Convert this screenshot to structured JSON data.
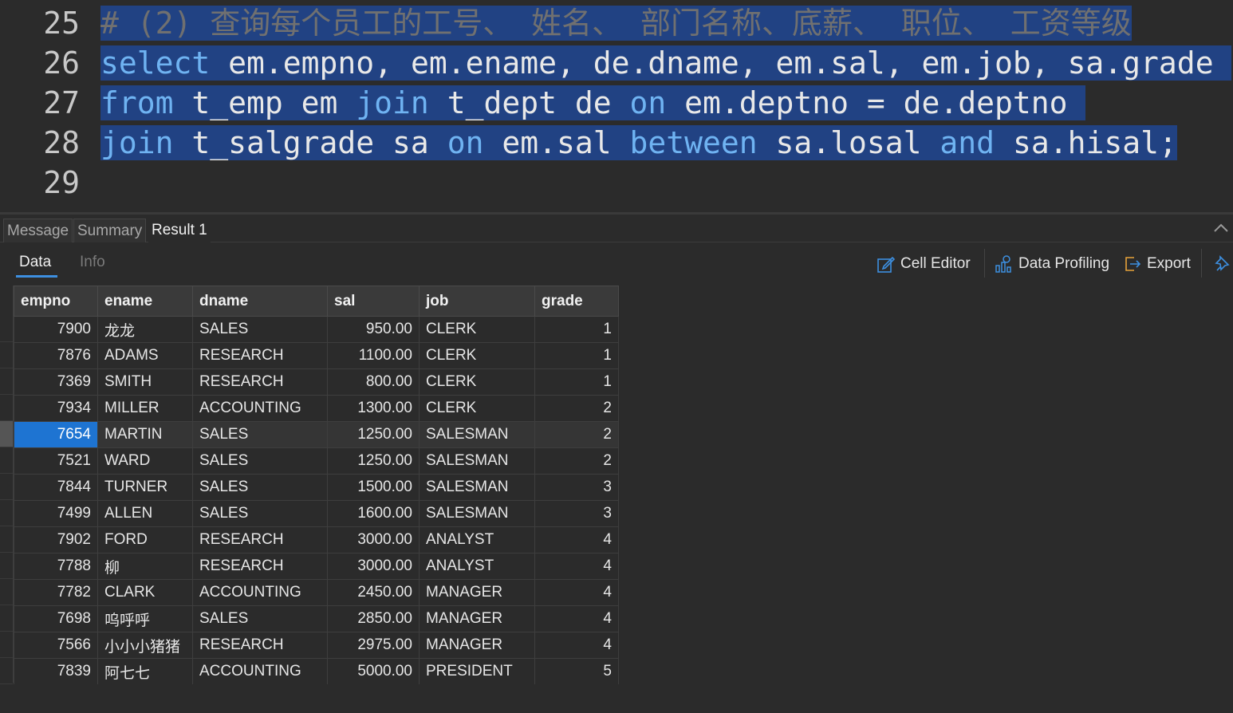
{
  "editor": {
    "lines": [
      {
        "num": "25",
        "tokens": [
          {
            "t": "# (2) 查询每个员工的工号、 姓名、 部门名称、底薪、 职位、 工资等级",
            "c": "cm"
          }
        ]
      },
      {
        "num": "26",
        "tokens": [
          {
            "t": "select",
            "c": "kw"
          },
          {
            "t": " em.empno, em.ename, de.dname, em.sal, em.job, sa.grade ",
            "c": ""
          }
        ]
      },
      {
        "num": "27",
        "tokens": [
          {
            "t": "from",
            "c": "kw"
          },
          {
            "t": " t_emp em ",
            "c": ""
          },
          {
            "t": "join",
            "c": "kw"
          },
          {
            "t": " t_dept de ",
            "c": ""
          },
          {
            "t": "on",
            "c": "kw"
          },
          {
            "t": " em.deptno = de.deptno ",
            "c": ""
          }
        ]
      },
      {
        "num": "28",
        "tokens": [
          {
            "t": "join",
            "c": "kw"
          },
          {
            "t": " t_salgrade sa ",
            "c": ""
          },
          {
            "t": "on",
            "c": "kw"
          },
          {
            "t": " em.sal ",
            "c": ""
          },
          {
            "t": "between",
            "c": "kw"
          },
          {
            "t": " sa.losal ",
            "c": ""
          },
          {
            "t": "and",
            "c": "kw"
          },
          {
            "t": " sa.hisal;",
            "c": ""
          }
        ]
      },
      {
        "num": "29",
        "tokens": []
      }
    ]
  },
  "panel_tabs": {
    "message": "Message",
    "summary": "Summary",
    "result": "Result 1"
  },
  "subtabs": {
    "data": "Data",
    "info": "Info"
  },
  "toolbar": {
    "cell_editor": "Cell Editor",
    "data_profiling": "Data Profiling",
    "export": "Export"
  },
  "grid": {
    "columns": [
      "empno",
      "ename",
      "dname",
      "sal",
      "job",
      "grade"
    ],
    "rows": [
      [
        "7900",
        "龙龙",
        "SALES",
        "950.00",
        "CLERK",
        "1"
      ],
      [
        "7876",
        "ADAMS",
        "RESEARCH",
        "1100.00",
        "CLERK",
        "1"
      ],
      [
        "7369",
        "SMITH",
        "RESEARCH",
        "800.00",
        "CLERK",
        "1"
      ],
      [
        "7934",
        "MILLER",
        "ACCOUNTING",
        "1300.00",
        "CLERK",
        "2"
      ],
      [
        "7654",
        "MARTIN",
        "SALES",
        "1250.00",
        "SALESMAN",
        "2"
      ],
      [
        "7521",
        "WARD",
        "SALES",
        "1250.00",
        "SALESMAN",
        "2"
      ],
      [
        "7844",
        "TURNER",
        "SALES",
        "1500.00",
        "SALESMAN",
        "3"
      ],
      [
        "7499",
        "ALLEN",
        "SALES",
        "1600.00",
        "SALESMAN",
        "3"
      ],
      [
        "7902",
        "FORD",
        "RESEARCH",
        "3000.00",
        "ANALYST",
        "4"
      ],
      [
        "7788",
        "柳",
        "RESEARCH",
        "3000.00",
        "ANALYST",
        "4"
      ],
      [
        "7782",
        "CLARK",
        "ACCOUNTING",
        "2450.00",
        "MANAGER",
        "4"
      ],
      [
        "7698",
        "呜呼呼",
        "SALES",
        "2850.00",
        "MANAGER",
        "4"
      ],
      [
        "7566",
        "小小小猪猪",
        "RESEARCH",
        "2975.00",
        "MANAGER",
        "4"
      ],
      [
        "7839",
        "阿七七",
        "ACCOUNTING",
        "5000.00",
        "PRESIDENT",
        "5"
      ]
    ],
    "selected_row": 4
  },
  "colors": {
    "selection": "#214283",
    "keyword": "#6fb3f2",
    "accent": "#1e74d2"
  }
}
